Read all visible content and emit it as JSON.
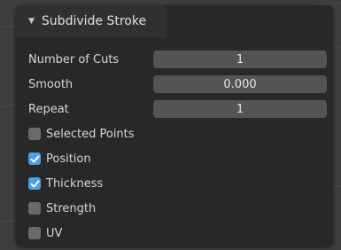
{
  "panel": {
    "title": "Subdivide Stroke",
    "collapse_icon": "triangle-down-icon"
  },
  "fields": [
    {
      "label": "Number of Cuts",
      "value": "1"
    },
    {
      "label": "Smooth",
      "value": "0.000"
    },
    {
      "label": "Repeat",
      "value": "1"
    }
  ],
  "checkboxes": [
    {
      "label": "Selected Points",
      "checked": false
    },
    {
      "label": "Position",
      "checked": true
    },
    {
      "label": "Thickness",
      "checked": true
    },
    {
      "label": "Strength",
      "checked": false
    },
    {
      "label": "UV",
      "checked": false
    }
  ],
  "colors": {
    "checkbox_on": "#4c9ee6",
    "checkbox_off": "#6a6a6a",
    "field_bg": "#545454",
    "panel_bg": "#282828"
  }
}
